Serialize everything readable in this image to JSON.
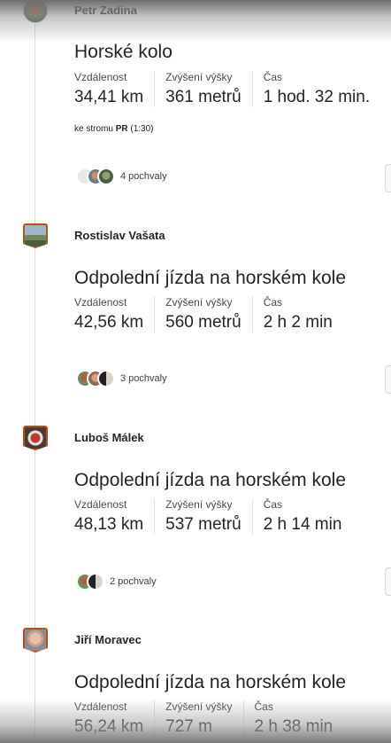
{
  "feed": [
    {
      "athlete": "Petr Zadina",
      "title": "Horské kolo",
      "stats": [
        {
          "label": "Vzdálenost",
          "value": "34,41 km"
        },
        {
          "label": "Zvýšení výšky",
          "value": "361 metrů"
        },
        {
          "label": "Čas",
          "value": "1 hod. 32 min."
        }
      ],
      "segment": {
        "prefix": "ke stromu",
        "badge": "PR",
        "time": "(1:30)"
      },
      "kudos": "4 pochvaly"
    },
    {
      "athlete": "Rostislav Vašata",
      "title": "Odpolední jízda na horském kole",
      "stats": [
        {
          "label": "Vzdálenost",
          "value": "42,56 km"
        },
        {
          "label": "Zvýšení výšky",
          "value": "560 metrů"
        },
        {
          "label": "Čas",
          "value": "2 h 2 min"
        }
      ],
      "kudos": "3 pochvaly"
    },
    {
      "athlete": "Luboš Málek",
      "title": "Odpolední jízda na horském kole",
      "stats": [
        {
          "label": "Vzdálenost",
          "value": "48,13 km"
        },
        {
          "label": "Zvýšení výšky",
          "value": "537 metrů"
        },
        {
          "label": "Čas",
          "value": "2 h 14 min"
        }
      ],
      "kudos": "2 pochvaly"
    },
    {
      "athlete": "Jiří Moravec",
      "title": "Odpolední jízda na horském kole",
      "stats": [
        {
          "label": "Vzdálenost",
          "value": "56,24 km"
        },
        {
          "label": "Zvýšení výšky",
          "value": "727 m"
        },
        {
          "label": "Čas",
          "value": "2 h 38 min"
        }
      ]
    }
  ],
  "colors": {
    "text": "#242428",
    "badge_border": "#b5531f",
    "timeline": "#dcdce0"
  }
}
